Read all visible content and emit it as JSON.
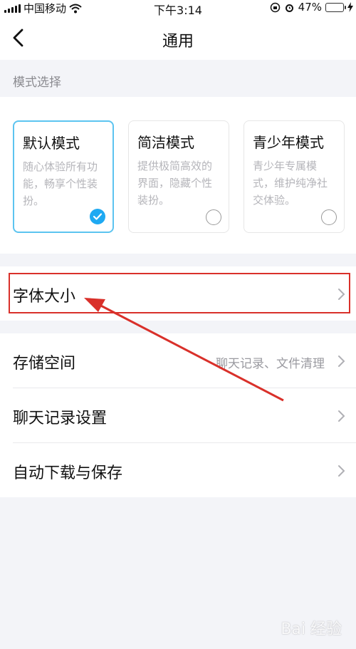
{
  "status_bar": {
    "carrier": "中国移动",
    "time": "下午3:14",
    "battery_percent": "47%",
    "battery_level": 0.47
  },
  "nav": {
    "title": "通用"
  },
  "mode_section": {
    "label": "模式选择",
    "modes": [
      {
        "title": "默认模式",
        "description": "随心体验所有功能，畅享个性装扮。",
        "selected": true
      },
      {
        "title": "简洁模式",
        "description": "提供极简高效的界面，隐藏个性装扮。",
        "selected": false
      },
      {
        "title": "青少年模式",
        "description": "青少年专属模式，维护纯净社交体验。",
        "selected": false
      }
    ]
  },
  "settings": {
    "font_size": {
      "label": "字体大小"
    },
    "storage": {
      "label": "存储空间",
      "value": "聊天记录、文件清理"
    },
    "chat_history": {
      "label": "聊天记录设置"
    },
    "auto_download": {
      "label": "自动下载与保存"
    }
  },
  "watermark": "Bai 经验",
  "colors": {
    "accent": "#1ea9f2",
    "selected_border": "#5cc4f0",
    "annotation": "#d9302a",
    "background": "#f3f4f8"
  }
}
